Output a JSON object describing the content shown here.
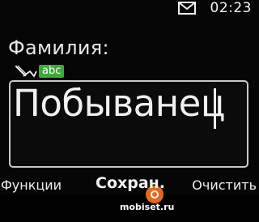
{
  "status_bar": {
    "message_icon": "envelope-icon",
    "time": "02:23"
  },
  "field": {
    "label": "Фамилия:",
    "input_mode_icon": "pen-icon",
    "input_mode": "abc",
    "value": "Побыванец"
  },
  "watermark": {
    "text": "mobiset.ru"
  },
  "softkeys": {
    "left": "Функции",
    "center": "Сохран.",
    "right": "Очистить"
  },
  "colors": {
    "background": "#050505",
    "text": "#f0f0f0",
    "mode_badge": "#3ea93a",
    "watermark_logo": "#e36a1c"
  }
}
